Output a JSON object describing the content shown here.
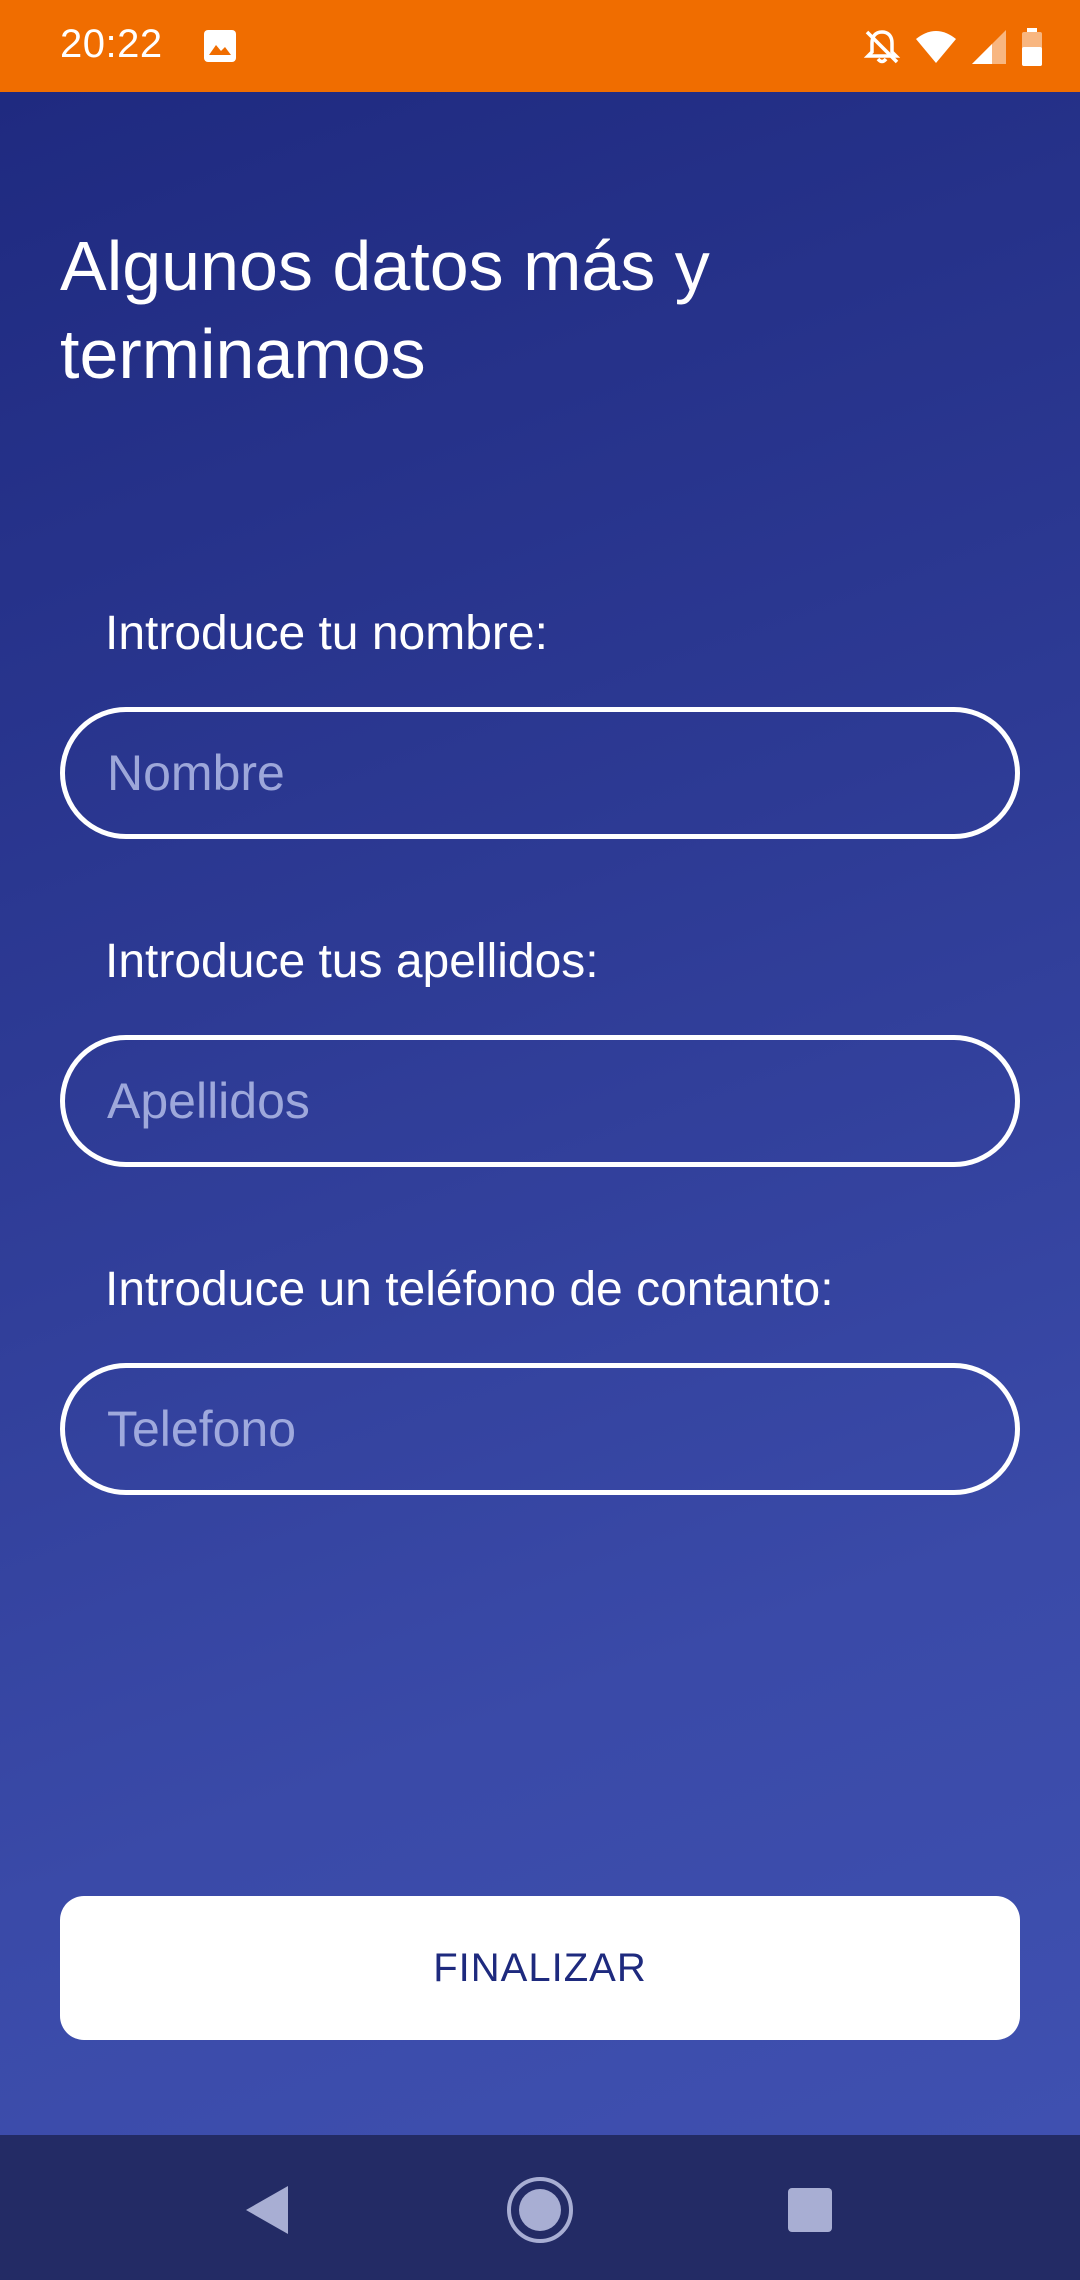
{
  "status_bar": {
    "time": "20:22",
    "icons": [
      "image-icon",
      "notifications-off-icon",
      "wifi-icon",
      "signal-icon",
      "battery-icon"
    ],
    "background_color": "#f06d00"
  },
  "page": {
    "title_line1": "Algunos datos más y",
    "title_line2": "terminamos",
    "gradient_colors": [
      "#1f2a80",
      "#3f50b0"
    ]
  },
  "form": {
    "name": {
      "label": "Introduce tu nombre:",
      "placeholder": "Nombre",
      "value": ""
    },
    "surname": {
      "label": "Introduce tus apellidos:",
      "placeholder": "Apellidos",
      "value": ""
    },
    "phone": {
      "label": "Introduce un teléfono de contanto:",
      "placeholder": "Telefono",
      "value": ""
    }
  },
  "actions": {
    "finish_label": "FINALIZAR"
  },
  "nav_bar": {
    "icons": [
      "back-icon",
      "home-icon",
      "recents-icon"
    ],
    "background_color": "#232b65"
  }
}
